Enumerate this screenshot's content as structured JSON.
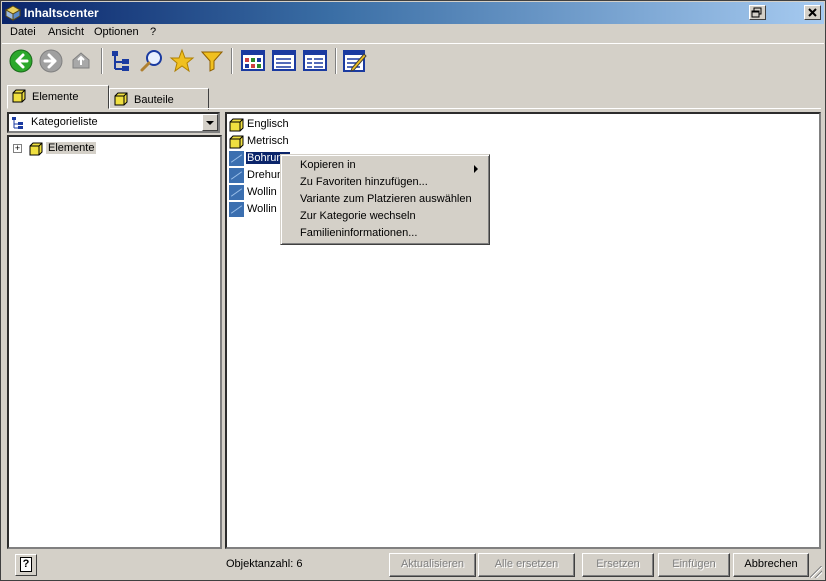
{
  "window": {
    "title": "Inhaltscenter"
  },
  "menubar": {
    "items": [
      "Datei",
      "Ansicht",
      "Optionen",
      "?"
    ]
  },
  "toolbar": {
    "buttons": [
      "back-icon",
      "forward-icon",
      "up-icon",
      "tree-view-icon",
      "search-icon",
      "favorites-star-icon",
      "filter-icon",
      "large-icons-view-icon",
      "list-view-icon",
      "details-view-icon",
      "edit-table-icon"
    ]
  },
  "tabs": [
    {
      "label": "Elemente",
      "active": true
    },
    {
      "label": "Bauteile",
      "active": false
    }
  ],
  "left_pane": {
    "dropdown": {
      "value": "Kategorieliste"
    },
    "tree": [
      {
        "label": "Elemente",
        "expander": "+"
      }
    ]
  },
  "right_pane": {
    "items": [
      {
        "label": "Englisch",
        "type": "folder"
      },
      {
        "label": "Metrisch",
        "type": "folder"
      },
      {
        "label": "Bohrung",
        "type": "feature",
        "selected": true
      },
      {
        "label": "Drehun",
        "type": "feature"
      },
      {
        "label": "Wollin L",
        "type": "feature"
      },
      {
        "label": "Wollin L",
        "type": "feature"
      }
    ]
  },
  "context_menu": {
    "items": [
      {
        "label": "Kopieren in",
        "submenu": true
      },
      {
        "label": "Zu Favoriten hinzufügen..."
      },
      {
        "label": "Variante zum Platzieren auswählen"
      },
      {
        "label": "Zur Kategorie wechseln"
      },
      {
        "label": "Familieninformationen..."
      }
    ]
  },
  "statusbar": {
    "help_label": "?",
    "object_count": "Objektanzahl: 6",
    "buttons": [
      {
        "label": "Aktualisieren",
        "enabled": false
      },
      {
        "label": "Alle ersetzen",
        "enabled": false
      },
      {
        "label": "Ersetzen",
        "enabled": false
      },
      {
        "label": "Einfügen",
        "enabled": false
      },
      {
        "label": "Abbrechen",
        "enabled": true
      }
    ]
  },
  "colors": {
    "face": "#d4d0c8",
    "title_start": "#0a246a",
    "selection": "#0a246a",
    "folder": "#f0e040"
  }
}
